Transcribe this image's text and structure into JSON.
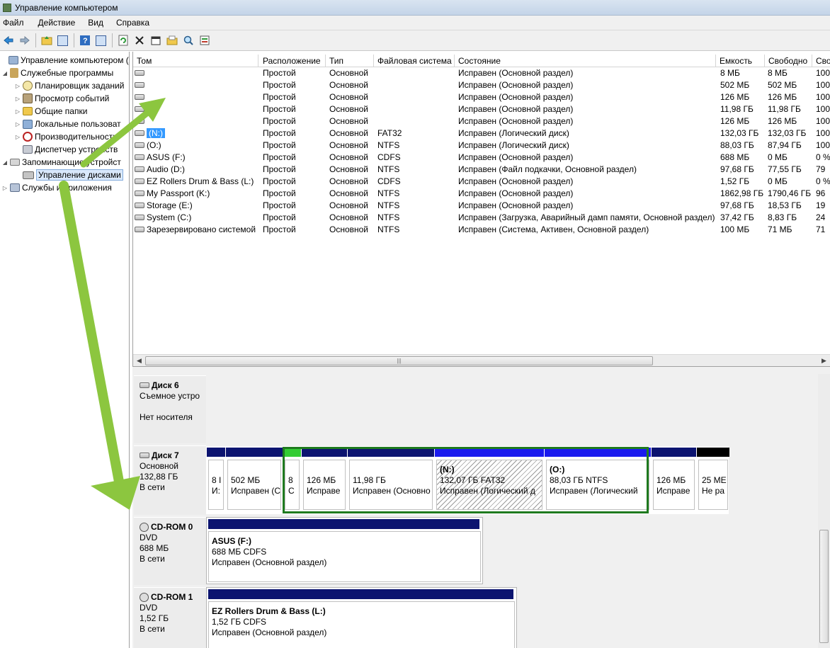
{
  "window": {
    "title": "Управление компьютером"
  },
  "menu": [
    "Файл",
    "Действие",
    "Вид",
    "Справка"
  ],
  "toolbar": [
    "back-icon",
    "forward-icon",
    "up-folder-icon",
    "show-hide-tree-icon",
    "help-icon",
    "console-icon",
    "refresh-icon",
    "delete-icon",
    "properties-icon",
    "open-icon",
    "search-icon",
    "export-icon"
  ],
  "tree": [
    {
      "label": "Управление компьютером (л",
      "icon": "computer-icon",
      "twisty": ""
    },
    {
      "label": "Служебные программы",
      "icon": "tools-icon",
      "twisty": "◢"
    },
    {
      "label": "Планировщик заданий",
      "icon": "clock-icon",
      "twisty": "▷"
    },
    {
      "label": "Просмотр событий",
      "icon": "event-log-icon",
      "twisty": "▷"
    },
    {
      "label": "Общие папки",
      "icon": "shared-folder-icon",
      "twisty": "▷"
    },
    {
      "label": "Локальные пользоват",
      "icon": "users-icon",
      "twisty": "▷"
    },
    {
      "label": "Производительность",
      "icon": "performance-icon",
      "twisty": "▷"
    },
    {
      "label": "Диспетчер устройств",
      "icon": "device-manager-icon",
      "twisty": ""
    },
    {
      "label": "Запоминающие устройст",
      "icon": "storage-icon",
      "twisty": "◢"
    },
    {
      "label": "Управление дисками",
      "icon": "disk-management-icon",
      "twisty": ""
    },
    {
      "label": "Службы и приложения",
      "icon": "services-icon",
      "twisty": "▷"
    }
  ],
  "volumes": {
    "columns": [
      "Том",
      "Расположение",
      "Тип",
      "Файловая система",
      "Состояние",
      "Емкость",
      "Свободно",
      "Сво"
    ],
    "rows": [
      [
        "",
        "Простой",
        "Основной",
        "",
        "Исправен (Основной раздел)",
        "8 МБ",
        "8 МБ",
        "100"
      ],
      [
        "",
        "Простой",
        "Основной",
        "",
        "Исправен (Основной раздел)",
        "502 МБ",
        "502 МБ",
        "100"
      ],
      [
        "",
        "Простой",
        "Основной",
        "",
        "Исправен (Основной раздел)",
        "126 МБ",
        "126 МБ",
        "100"
      ],
      [
        "",
        "Простой",
        "Основной",
        "",
        "Исправен (Основной раздел)",
        "11,98 ГБ",
        "11,98 ГБ",
        "100"
      ],
      [
        "",
        "Простой",
        "Основной",
        "",
        "Исправен (Основной раздел)",
        "126 МБ",
        "126 МБ",
        "100"
      ],
      [
        "(N:)",
        "Простой",
        "Основной",
        "FAT32",
        "Исправен (Логический диск)",
        "132,03 ГБ",
        "132,03 ГБ",
        "100"
      ],
      [
        "(O:)",
        "Простой",
        "Основной",
        "NTFS",
        "Исправен (Логический диск)",
        "88,03 ГБ",
        "87,94 ГБ",
        "100"
      ],
      [
        "ASUS (F:)",
        "Простой",
        "Основной",
        "CDFS",
        "Исправен (Основной раздел)",
        "688 МБ",
        "0 МБ",
        "0 %"
      ],
      [
        "Audio (D:)",
        "Простой",
        "Основной",
        "NTFS",
        "Исправен (Файл подкачки, Основной раздел)",
        "97,68 ГБ",
        "77,55 ГБ",
        "79"
      ],
      [
        "EZ Rollers Drum & Bass (L:)",
        "Простой",
        "Основной",
        "CDFS",
        "Исправен (Основной раздел)",
        "1,52 ГБ",
        "0 МБ",
        "0 %"
      ],
      [
        "My Passport (K:)",
        "Простой",
        "Основной",
        "NTFS",
        "Исправен (Основной раздел)",
        "1862,98 ГБ",
        "1790,46 ГБ",
        "96"
      ],
      [
        "Storage (E:)",
        "Простой",
        "Основной",
        "NTFS",
        "Исправен (Основной раздел)",
        "97,68 ГБ",
        "18,53 ГБ",
        "19"
      ],
      [
        "System (C:)",
        "Простой",
        "Основной",
        "NTFS",
        "Исправен (Загрузка, Аварийный дамп памяти, Основной раздел)",
        "37,42 ГБ",
        "8,83 ГБ",
        "24"
      ],
      [
        "Зарезервировано системой",
        "Простой",
        "Основной",
        "NTFS",
        "Исправен (Система, Активен, Основной раздел)",
        "100 МБ",
        "71 МБ",
        "71"
      ]
    ]
  },
  "scroll": {
    "grip": "|||"
  },
  "disks": [
    {
      "name": "Диск 6",
      "lines": [
        "Съемное устро",
        "",
        "Нет носителя"
      ]
    },
    {
      "name": "Диск 7",
      "lines": [
        "Основной",
        "132,88 ГБ",
        "В сети"
      ]
    },
    {
      "name": "CD-ROM 0",
      "lines": [
        "DVD",
        "688 МБ",
        "В сети"
      ]
    },
    {
      "name": "CD-ROM 1",
      "lines": [
        "DVD",
        "1,52 ГБ",
        "В сети"
      ]
    }
  ],
  "disk7_parts": [
    {
      "l1": "",
      "l2": "8 I",
      "l3": "И:",
      "bar": "#0c1470"
    },
    {
      "l1": "",
      "l2": "502 МБ",
      "l3": "Исправен (С",
      "bar": "#0c1470"
    },
    {
      "l1": "",
      "l2": "8",
      "l3": "С",
      "bar": "#33cc33"
    },
    {
      "l1": "",
      "l2": "126 МБ",
      "l3": "Исправе",
      "bar": "#0c1470"
    },
    {
      "l1": "",
      "l2": "11,98 ГБ",
      "l3": "Исправен (Основно",
      "bar": "#0c1470"
    },
    {
      "l1": "(N:)",
      "l2": "132,07 ГБ FAT32",
      "l3": "Исправен (Логический д",
      "bar": "#1a1aee"
    },
    {
      "l1": "(O:)",
      "l2": "88,03 ГБ NTFS",
      "l3": "Исправен (Логический",
      "bar": "#1a1aee"
    },
    {
      "l1": "",
      "l2": "126 МБ",
      "l3": "Исправе",
      "bar": "#0c1470"
    },
    {
      "l1": "",
      "l2": "25 МЕ",
      "l3": "Не ра",
      "bar": "#000000"
    }
  ],
  "cd0_part": {
    "l1": "ASUS  (F:)",
    "l2": "688 МБ CDFS",
    "l3": "Исправен (Основной раздел)"
  },
  "cd1_part": {
    "l1": "EZ Rollers Drum & Bass  (L:)",
    "l2": "1,52 ГБ CDFS",
    "l3": "Исправен (Основной раздел)"
  },
  "colors": {
    "primary": "#0c1470",
    "logical": "#1a1aee",
    "selection_green": "#1f7a1f",
    "annotation_arrow": "#8cc63f"
  }
}
